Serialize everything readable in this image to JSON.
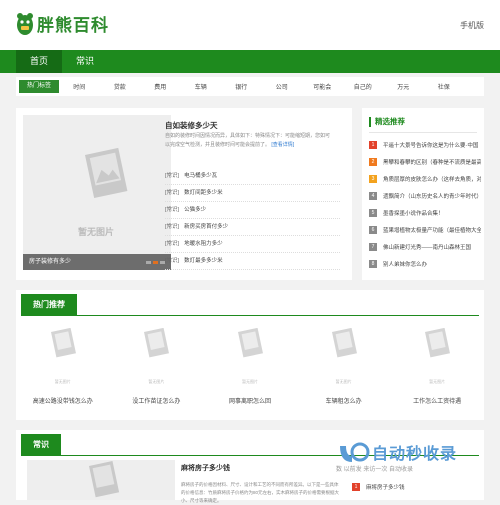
{
  "header": {
    "logo_text": "胖熊百科",
    "mobile_link": "手机版"
  },
  "nav": {
    "items": [
      {
        "label": "首页",
        "active": true
      },
      {
        "label": "常识",
        "active": false
      }
    ]
  },
  "subnav": {
    "hot_label": "热门标签",
    "items": [
      "时间",
      "贷款",
      "费用",
      "车辆",
      "银行",
      "公司",
      "可能会",
      "自己的",
      "万元",
      "社保"
    ]
  },
  "featured": {
    "placeholder_text": "暂无图片",
    "caption": "房子装修有多少",
    "title": "自如装修多少天",
    "summary": "自如的装修时间因情况而异，具体如下：特殊情况下：可能缩短期，您如可以完成空气检测，并且装修时间可能会提前了。",
    "more_label": "[查看详情]",
    "questions": [
      {
        "tag": "[常识]",
        "text": "电马桶多少瓦"
      },
      {
        "tag": "[常识]",
        "text": "数灯间距多少米"
      },
      {
        "tag": "[常识]",
        "text": "公猫多少"
      },
      {
        "tag": "[常识]",
        "text": "新房买房首付多少"
      },
      {
        "tag": "[常识]",
        "text": "地暖水阻力多少"
      },
      {
        "tag": "[常识]",
        "text": "数灯最多多少米"
      }
    ]
  },
  "recommend": {
    "title": "精选推荐",
    "items": [
      {
        "num": "1",
        "text": "平遥十大景号告诉你这是为什么要·中国",
        "color": "#e2422b"
      },
      {
        "num": "2",
        "text": "黑攀和春攀的区别（春种是不流质是最高的",
        "color": "#f07a1e"
      },
      {
        "num": "3",
        "text": "角质层厚的皮肤怎么办（这样去角质，对肌",
        "color": "#f3a21e"
      },
      {
        "num": "4",
        "text": "遗飘简介（山东历史名人的青少年时代）",
        "color": "#8a8a8a"
      },
      {
        "num": "5",
        "text": "墨香探墨小说作品合集！",
        "color": "#8a8a8a"
      },
      {
        "num": "6",
        "text": "蓝果增植物太极量产功能（最佳植物大全）",
        "color": "#8a8a8a"
      },
      {
        "num": "7",
        "text": "佛山新建灯光秀——南丹山森林王国",
        "color": "#8a8a8a"
      },
      {
        "num": "8",
        "text": "别人弟妹你怎么办",
        "color": "#8a8a8a"
      }
    ]
  },
  "hot": {
    "title": "热门推荐",
    "placeholder_text": "暂无图片",
    "items": [
      "高速公路没带钱怎么办",
      "没工作苗证怎么办",
      "网事离职怎么回",
      "车辆租怎么办",
      "工作怎么工资待遇"
    ]
  },
  "common": {
    "title": "常识",
    "article_title": "麻将房子多少钱",
    "article_summary": "麻将房子的价格因材料、尺寸、设计和工艺的不同而有所差异。以下是一些具体的价格信息：竹质麻将房子价格约为80元左右，实木麻将房子的价格需要根据大小、尺寸等来确定。",
    "right_item": {
      "num": "1",
      "text": "麻将房子多少钱",
      "color": "#e2422b"
    }
  },
  "watermark": {
    "big": "自动秒收录",
    "small": "数   以前发   来访一次   自动收录"
  }
}
